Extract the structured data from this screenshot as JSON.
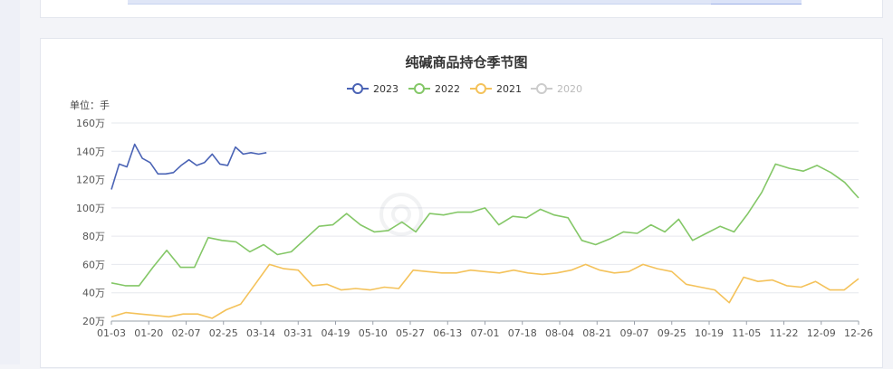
{
  "chart_data": {
    "type": "line",
    "title": "纯碱商品持仓季节图",
    "y_unit_label": "单位：手",
    "y_ticks": [
      "20万",
      "40万",
      "60万",
      "80万",
      "100万",
      "120万",
      "140万",
      "160万"
    ],
    "ylim": [
      200000,
      1600000
    ],
    "x_ticks": [
      "01-03",
      "01-20",
      "02-07",
      "02-25",
      "03-14",
      "03-31",
      "04-19",
      "05-10",
      "05-27",
      "06-13",
      "07-01",
      "07-18",
      "08-04",
      "08-21",
      "09-07",
      "09-25",
      "10-19",
      "11-05",
      "11-22",
      "12-09",
      "12-26"
    ],
    "grid": true,
    "legend_position": "top-center",
    "series": [
      {
        "name": "2023",
        "color": "#4a63b5",
        "visible": true,
        "values": [
          1130000,
          1310000,
          1290000,
          1450000,
          1350000,
          1320000,
          1240000,
          1240000,
          1250000,
          1300000,
          1340000,
          1300000,
          1320000,
          1380000,
          1310000,
          1300000,
          1430000,
          1380000,
          1390000,
          1380000,
          1390000
        ]
      },
      {
        "name": "2022",
        "color": "#84c767",
        "visible": true,
        "values": [
          470000,
          450000,
          450000,
          580000,
          700000,
          580000,
          580000,
          790000,
          770000,
          760000,
          690000,
          740000,
          670000,
          690000,
          780000,
          870000,
          880000,
          960000,
          880000,
          830000,
          840000,
          900000,
          830000,
          960000,
          950000,
          970000,
          970000,
          1000000,
          880000,
          940000,
          930000,
          990000,
          950000,
          930000,
          770000,
          740000,
          780000,
          830000,
          820000,
          880000,
          830000,
          920000,
          770000,
          820000,
          870000,
          830000,
          960000,
          1110000,
          1310000,
          1280000,
          1260000,
          1300000,
          1250000,
          1180000,
          1070000
        ]
      },
      {
        "name": "2021",
        "color": "#f4c25a",
        "visible": true,
        "values": [
          230000,
          260000,
          250000,
          240000,
          230000,
          250000,
          250000,
          220000,
          280000,
          320000,
          460000,
          600000,
          570000,
          560000,
          450000,
          460000,
          420000,
          430000,
          420000,
          440000,
          430000,
          560000,
          550000,
          540000,
          540000,
          560000,
          550000,
          540000,
          560000,
          540000,
          530000,
          540000,
          560000,
          600000,
          560000,
          540000,
          550000,
          600000,
          570000,
          550000,
          460000,
          440000,
          420000,
          330000,
          510000,
          480000,
          490000,
          450000,
          440000,
          480000,
          420000,
          420000,
          500000
        ]
      },
      {
        "name": "2020",
        "color": "#cccccc",
        "visible": false,
        "values": []
      }
    ]
  }
}
